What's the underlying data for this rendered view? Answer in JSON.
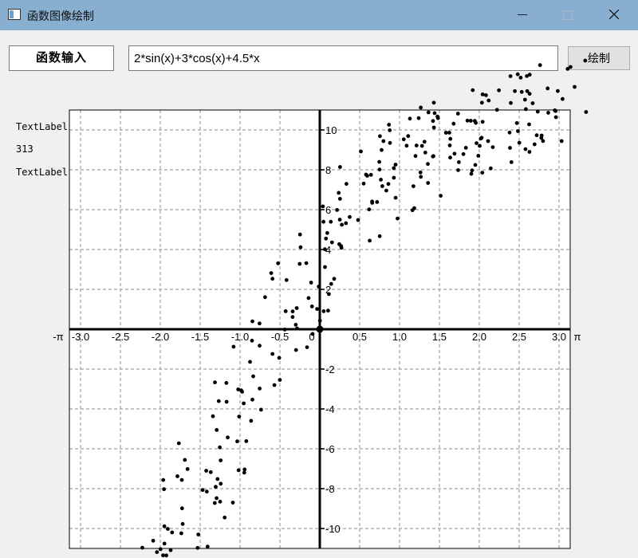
{
  "window": {
    "title": "函数图像绘制"
  },
  "toolbar": {
    "input_label": "函数输入",
    "function_value": "2*sin(x)+3*cos(x)+4.5*x",
    "draw_button_label": "绘制"
  },
  "side_labels": {
    "label_1": "TextLabel",
    "value": "313",
    "label_2": "TextLabel"
  },
  "chart_data": {
    "type": "scatter",
    "expression": "2*sin(x)+3*cos(x)+4.5*x",
    "xlim": [
      -3.14159,
      3.14159
    ],
    "ylim": [
      -11,
      11
    ],
    "x_edge_labels": [
      "-π",
      "π"
    ],
    "x_ticks": [
      -3.0,
      -2.5,
      -2.0,
      -1.5,
      -1.0,
      -0.5,
      0,
      0.5,
      1.0,
      1.5,
      2.0,
      2.5,
      3.0
    ],
    "x_tick_labels": [
      "-3.0",
      "-2.5",
      "-2.0",
      "-1.5",
      "-1.0",
      "-0.5",
      "0",
      "0.5",
      "1.0",
      "1.5",
      "2.0",
      "2.5",
      "3.0"
    ],
    "y_ticks": [
      10,
      8,
      6,
      4,
      2,
      -2,
      -4,
      -6,
      -8,
      -10
    ],
    "y_tick_labels": [
      "10",
      "8",
      "6",
      "4",
      "2",
      "-2",
      "-4",
      "-6",
      "-8",
      "-10"
    ],
    "grid": true,
    "point_color": "#000000",
    "grid_color": "#a0a0a0",
    "point_count": 313
  }
}
